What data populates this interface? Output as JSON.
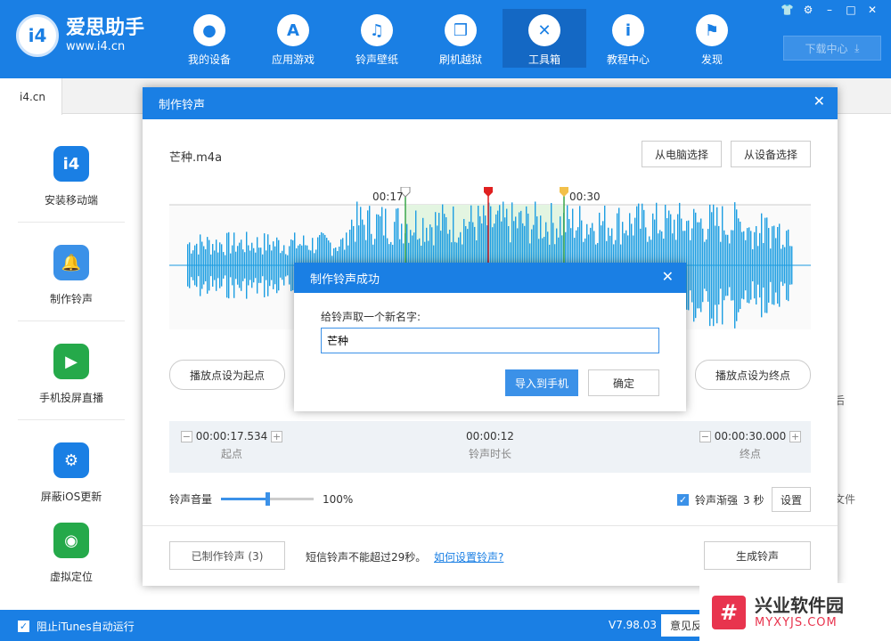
{
  "app": {
    "name": "爱思助手",
    "url": "www.i4.cn",
    "logo_text": "i4",
    "download_label": "下载中心",
    "win_icons": {
      "shirt": "👕",
      "gear": "⚙",
      "min": "–",
      "max": "□",
      "close": "✕"
    }
  },
  "nav": [
    {
      "label": "我的设备",
      "icon": ""
    },
    {
      "label": "应用游戏",
      "icon": "A"
    },
    {
      "label": "铃声壁纸",
      "icon": "♫"
    },
    {
      "label": "刷机越狱",
      "icon": "❒"
    },
    {
      "label": "工具箱",
      "icon": "✕"
    },
    {
      "label": "教程中心",
      "icon": "i"
    },
    {
      "label": "发现",
      "icon": "⚑"
    }
  ],
  "tab": {
    "label": "i4.cn"
  },
  "sidebar": [
    {
      "label": "安装移动端",
      "icon": "i4",
      "color": "#1a7fe4"
    },
    {
      "label": "制作铃声",
      "icon": "🔔",
      "color": "#3b91e8"
    },
    {
      "label": "手机投屏直播",
      "icon": "▶",
      "color": "#25a94a"
    },
    {
      "label": "屏蔽iOS更新",
      "icon": "⚙",
      "color": "#1a7fe4"
    },
    {
      "label": "虚拟定位",
      "icon": "◉",
      "color": "#25a94a"
    }
  ],
  "right_edge": {
    "a": "后",
    "b": "文件"
  },
  "status": {
    "itunes_label": "阻止iTunes自动运行",
    "version": "V7.98.03",
    "feedback": "意见反"
  },
  "ringtone": {
    "title": "制作铃声",
    "filename": "芒种.m4a",
    "btn_pc": "从电脑选择",
    "btn_device": "从设备选择",
    "marker_start": "00:17",
    "marker_end": "00:30",
    "btn_set_start": "播放点设为起点",
    "btn_set_end": "播放点设为终点",
    "start_time": "00:00:17.534",
    "start_label": "起点",
    "duration": "00:00:12",
    "duration_label": "铃声时长",
    "end_time": "00:00:30.000",
    "end_label": "终点",
    "volume_label": "铃声音量",
    "volume_value": "100%",
    "volume_fraction": 0.5,
    "fade_label": "铃声渐强",
    "fade_seconds": "3 秒",
    "settings_btn": "设置",
    "made_btn": "已制作铃声 (3)",
    "sms_note": "短信铃声不能超过29秒。",
    "howto_link": "如何设置铃声?",
    "generate_btn": "生成铃声"
  },
  "success": {
    "title": "制作铃声成功",
    "prompt": "给铃声取一个新名字:",
    "name_value": "芒种",
    "import_btn": "导入到手机",
    "ok_btn": "确定"
  },
  "watermark": {
    "logo": "#",
    "title": "兴业软件园",
    "url": "MYXYJS.COM"
  }
}
